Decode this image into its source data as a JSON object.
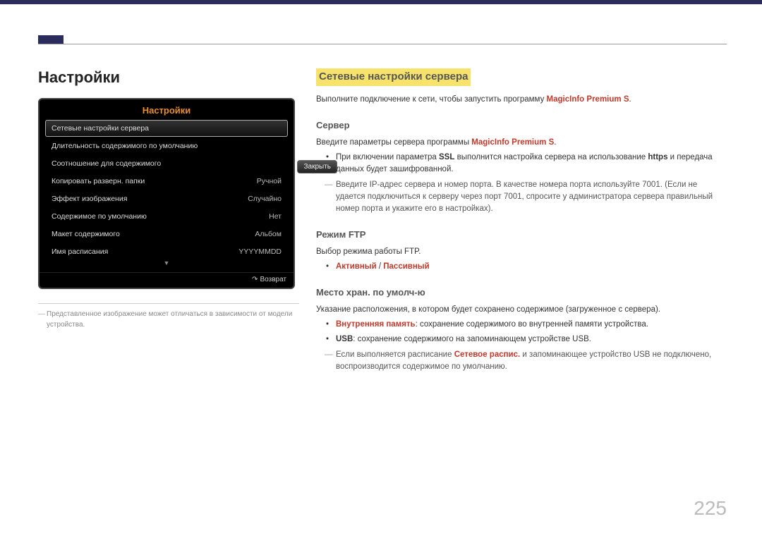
{
  "page_title": "Настройки",
  "page_number": "225",
  "highlight_heading": "Сетевые настройки сервера",
  "osd": {
    "title": "Настройки",
    "close": "Закрыть",
    "return": "Возврат",
    "rows": [
      {
        "label": "Сетевые настройки сервера",
        "value": ""
      },
      {
        "label": "Длительность содержимого по умолчанию",
        "value": ""
      },
      {
        "label": "Соотношение для содержимого",
        "value": ""
      },
      {
        "label": "Копировать разверн. папки",
        "value": "Ручной"
      },
      {
        "label": "Эффект изображения",
        "value": "Случайно"
      },
      {
        "label": "Содержимое по умолчанию",
        "value": "Нет"
      },
      {
        "label": "Макет содержимого",
        "value": "Альбом"
      },
      {
        "label": "Имя расписания",
        "value": "YYYYMMDD"
      }
    ]
  },
  "left_note": "Представленное изображение может отличаться в зависимости от модели устройства.",
  "intro": {
    "pre": "Выполните подключение к сети, чтобы запустить программу ",
    "prog": "MagicInfo Premium S",
    "post": "."
  },
  "server": {
    "heading": "Сервер",
    "line1_pre": "Введите параметры сервера программы ",
    "line1_prog": "MagicInfo Premium S",
    "line1_post": ".",
    "bullet_pre": "При включении параметра ",
    "bullet_ssl": "SSL",
    "bullet_mid": " выполнится настройка сервера на использование ",
    "bullet_https": "https",
    "bullet_post": " и передача данных будет зашифрованной.",
    "dash": "Введите IP-адрес сервера и номер порта. В качестве номера порта используйте 7001. (Если не удается подключиться к серверу через порт 7001, спросите у администратора сервера правильный номер порта и укажите его в настройках)."
  },
  "ftp": {
    "heading": "Режим FTP",
    "desc": "Выбор режима работы FTP.",
    "active": "Активный",
    "sep": " / ",
    "passive": "Пассивный"
  },
  "storage": {
    "heading": "Место хран. по умолч-ю",
    "desc": "Указание расположения, в котором будет сохранено содержимое (загруженное с сервера).",
    "b1_key": "Внутренняя память",
    "b1_rest": ": сохранение содержимого во внутренней памяти устройства.",
    "b2_key": "USB",
    "b2_rest": ": сохранение содержимого на запоминающем устройстве USB.",
    "dash_pre": "Если выполняется расписание ",
    "dash_key": "Сетевое распис.",
    "dash_post": " и запоминающее устройство USB не подключено, воспроизводится содержимое по умолчанию."
  }
}
